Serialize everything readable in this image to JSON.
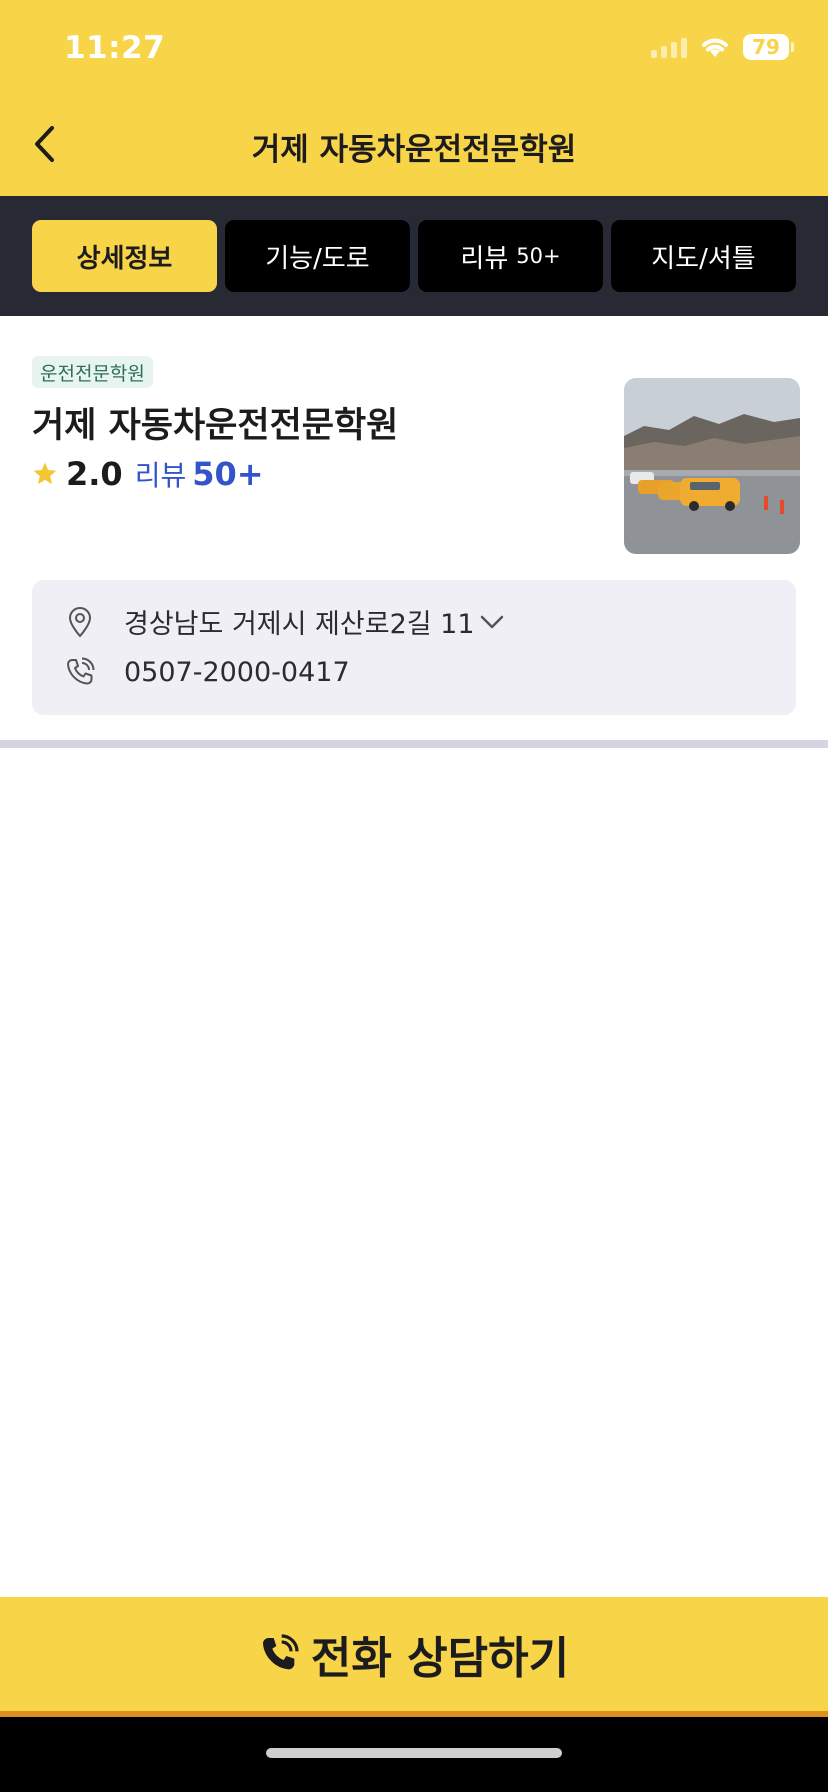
{
  "status_bar": {
    "time": "11:27",
    "battery": "79"
  },
  "nav": {
    "title": "거제 자동차운전전문학원"
  },
  "tabs": [
    {
      "label": "상세정보",
      "extra": "",
      "active": true
    },
    {
      "label": "기능/도로",
      "extra": ""
    },
    {
      "label": "리뷰",
      "extra": "50+"
    },
    {
      "label": "지도/셔틀",
      "extra": ""
    }
  ],
  "place": {
    "category": "운전전문학원",
    "name": "거제 자동차운전전문학원",
    "rating": "2.0",
    "review_label": "리뷰",
    "review_count": "50+"
  },
  "info": {
    "address": "경상남도 거제시 제산로2길 11",
    "phone": "0507-2000-0417"
  },
  "cta": {
    "label": "전화 상담하기"
  },
  "colors": {
    "brand_yellow": "#f8d449",
    "tab_bg": "#272a35",
    "review_blue": "#3355c9"
  }
}
